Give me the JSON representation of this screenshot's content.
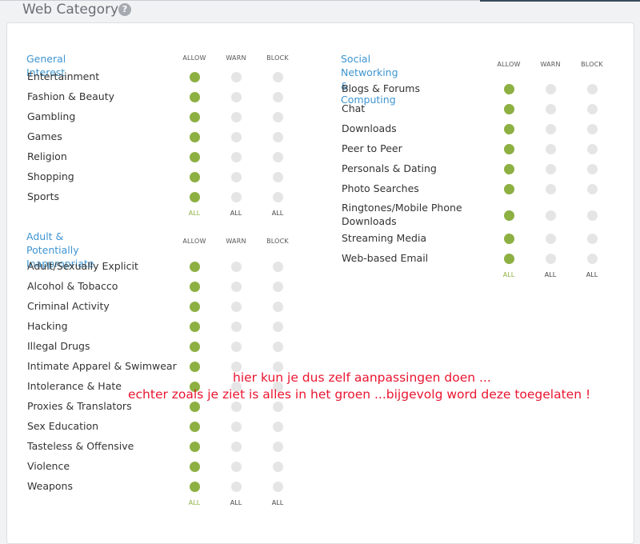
{
  "header": {
    "title": "Web Category",
    "help_icon": "?"
  },
  "columns": {
    "allow": "ALLOW",
    "warn": "WARN",
    "block": "BLOCK"
  },
  "all_labels": {
    "allow": "ALL",
    "warn": "ALL",
    "block": "ALL"
  },
  "colors": {
    "allowed": "#8db042",
    "inactive": "#e5e5e5",
    "section_title": "#3e95d1",
    "annotation": "#ea1530"
  },
  "sections": {
    "general": {
      "title": "General Interest",
      "items": [
        {
          "label": "Entertainment",
          "state": "allow"
        },
        {
          "label": "Fashion & Beauty",
          "state": "allow"
        },
        {
          "label": "Gambling",
          "state": "allow"
        },
        {
          "label": "Games",
          "state": "allow"
        },
        {
          "label": "Religion",
          "state": "allow"
        },
        {
          "label": "Shopping",
          "state": "allow"
        },
        {
          "label": "Sports",
          "state": "allow"
        }
      ]
    },
    "adult": {
      "title_line1": "Adult & Potentially",
      "title_line2": "Inappropriate",
      "items": [
        {
          "label": "Adult/Sexually Explicit",
          "state": "allow"
        },
        {
          "label": "Alcohol & Tobacco",
          "state": "allow"
        },
        {
          "label": "Criminal Activity",
          "state": "allow"
        },
        {
          "label": "Hacking",
          "state": "allow"
        },
        {
          "label": "Illegal Drugs",
          "state": "allow"
        },
        {
          "label": "Intimate Apparel & Swimwear",
          "state": "allow"
        },
        {
          "label": "Intolerance & Hate",
          "state": "allow"
        },
        {
          "label": "Proxies & Translators",
          "state": "allow"
        },
        {
          "label": "Sex Education",
          "state": "allow"
        },
        {
          "label": "Tasteless & Offensive",
          "state": "allow"
        },
        {
          "label": "Violence",
          "state": "allow"
        },
        {
          "label": "Weapons",
          "state": "allow"
        }
      ]
    },
    "social": {
      "title_line1": "Social Networking &",
      "title_line2": "Computing",
      "items": [
        {
          "label": "Blogs & Forums",
          "state": "allow"
        },
        {
          "label": "Chat",
          "state": "allow"
        },
        {
          "label": "Downloads",
          "state": "allow"
        },
        {
          "label": "Peer to Peer",
          "state": "allow"
        },
        {
          "label": "Personals & Dating",
          "state": "allow"
        },
        {
          "label": "Photo Searches",
          "state": "allow"
        },
        {
          "label": "Ringtones/Mobile Phone",
          "label_line2": "Downloads",
          "state": "allow"
        },
        {
          "label": "Streaming Media",
          "state": "allow"
        },
        {
          "label": "Web-based Email",
          "state": "allow"
        }
      ]
    }
  },
  "annotation": {
    "line1": "hier kun je dus zelf aanpassingen doen ...",
    "line2": "echter zoals je ziet is alles in het groen ...bijgevolg word deze toegelaten !"
  }
}
